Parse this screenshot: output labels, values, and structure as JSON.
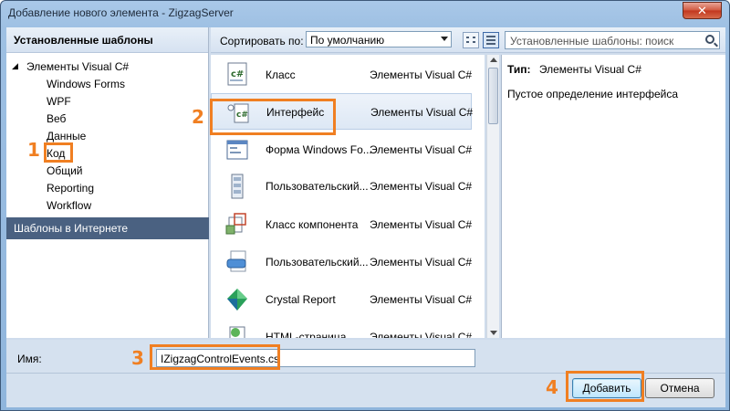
{
  "window": {
    "title": "Добавление нового элемента - ZigzagServer",
    "close_label": "✕"
  },
  "left_pane": {
    "header": "Установленные шаблоны",
    "root": "Элементы Visual C#",
    "children": [
      "Windows Forms",
      "WPF",
      "Веб",
      "Данные",
      "Код",
      "Общий",
      "Reporting",
      "Workflow"
    ],
    "online": "Шаблоны в Интернете"
  },
  "toolbar": {
    "sort_label": "Сортировать по:",
    "sort_value": "По умолчанию",
    "search_placeholder": "Установленные шаблоны: поиск"
  },
  "templates": [
    {
      "name": "Класс",
      "category": "Элементы Visual C#",
      "icon": "class-icon"
    },
    {
      "name": "Интерфейс",
      "category": "Элементы Visual C#",
      "icon": "interface-icon",
      "selected": true
    },
    {
      "name": "Форма Windows Fo...",
      "category": "Элементы Visual C#",
      "icon": "form-icon"
    },
    {
      "name": "Пользовательский...",
      "category": "Элементы Visual C#",
      "icon": "user-control-icon"
    },
    {
      "name": "Класс компонента",
      "category": "Элементы Visual C#",
      "icon": "component-icon"
    },
    {
      "name": "Пользовательский...",
      "category": "Элементы Visual C#",
      "icon": "custom-control-icon"
    },
    {
      "name": "Crystal Report",
      "category": "Элементы Visual C#",
      "icon": "crystal-report-icon"
    },
    {
      "name": "HTML-страница",
      "category": "Элементы Visual C#",
      "icon": "html-page-icon"
    }
  ],
  "info": {
    "type_label": "Тип:",
    "type_value": "Элементы Visual C#",
    "description": "Пустое определение интерфейса"
  },
  "bottom": {
    "name_label": "Имя:",
    "name_value": "IZigzagControlEvents.cs",
    "add_label": "Добавить",
    "cancel_label": "Отмена"
  },
  "annotations": [
    "1",
    "2",
    "3",
    "4"
  ],
  "colors": {
    "highlight": "#f07f22",
    "online_bar": "#4a6181"
  }
}
